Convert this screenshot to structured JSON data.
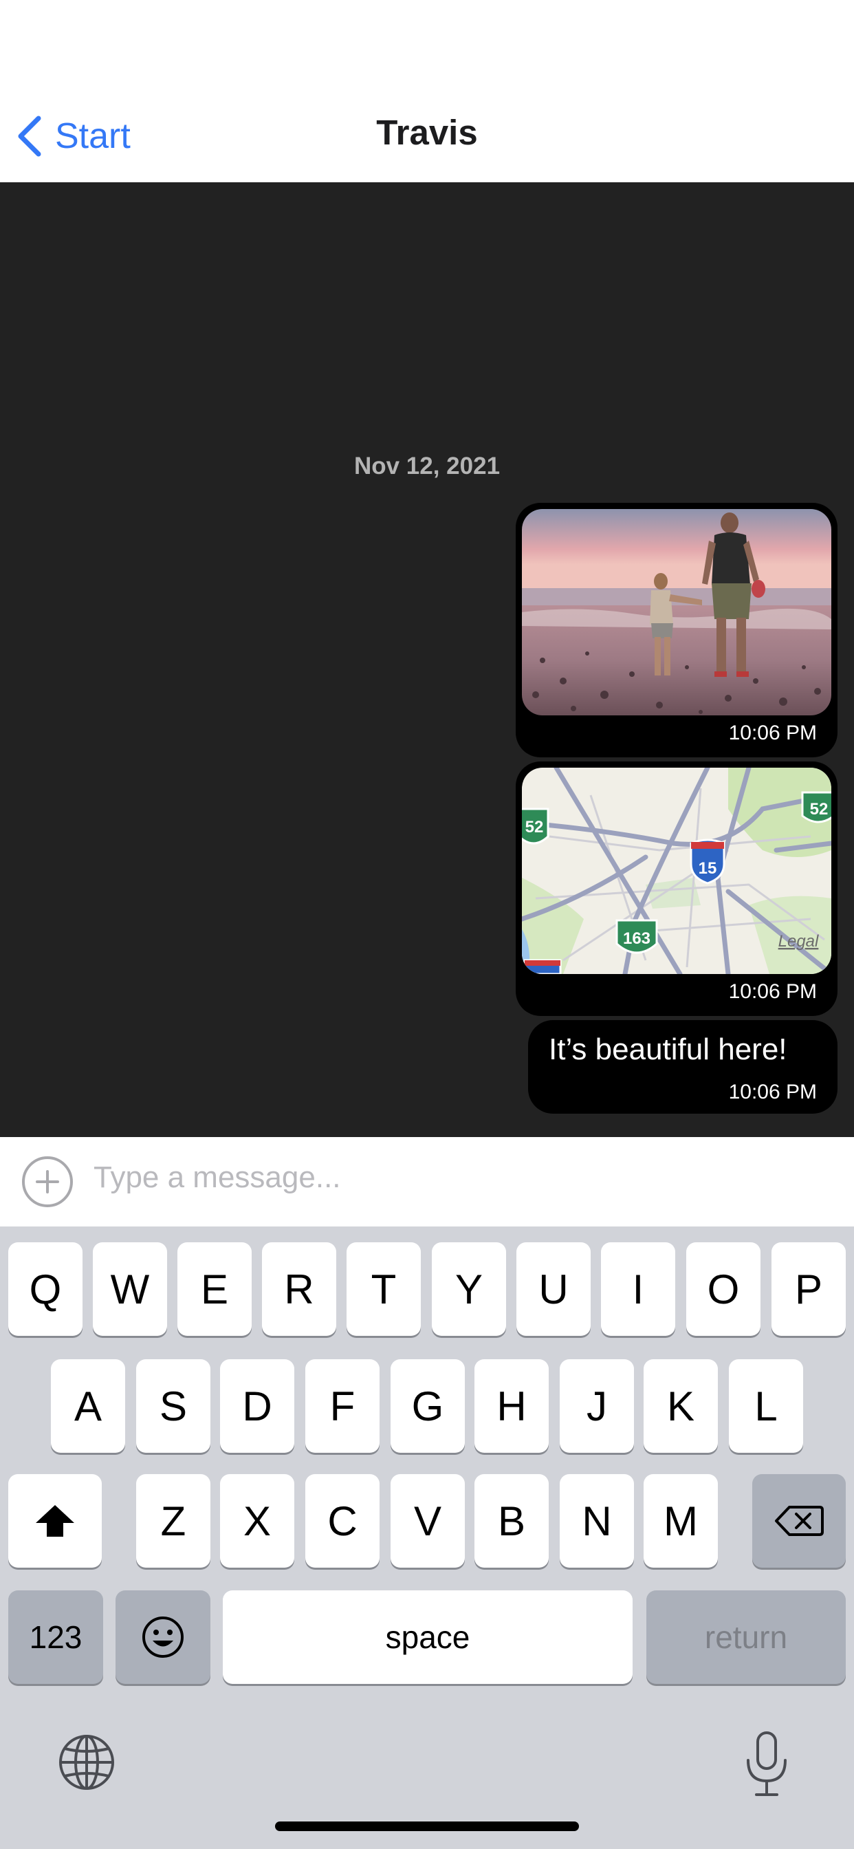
{
  "nav": {
    "back_label": "Start",
    "title": "Travis"
  },
  "chat": {
    "date_label": "Nov 12, 2021",
    "messages": [
      {
        "type": "photo",
        "time": "10:06 PM"
      },
      {
        "type": "map",
        "time": "10:06 PM",
        "route_labels": [
          "52",
          "15",
          "163",
          "52"
        ],
        "legal_label": "Legal"
      },
      {
        "type": "text",
        "text": "It’s beautiful here!",
        "time": "10:06 PM"
      }
    ]
  },
  "composer": {
    "placeholder": "Type a message..."
  },
  "keyboard": {
    "row1": [
      "Q",
      "W",
      "E",
      "R",
      "T",
      "Y",
      "U",
      "I",
      "O",
      "P"
    ],
    "row2": [
      "A",
      "S",
      "D",
      "F",
      "G",
      "H",
      "J",
      "K",
      "L"
    ],
    "row3": [
      "Z",
      "X",
      "C",
      "V",
      "B",
      "N",
      "M"
    ],
    "numbers_label": "123",
    "space_label": "space",
    "return_label": "return"
  },
  "icons": {
    "back": "chevron-left-icon",
    "add": "plus-circle-icon",
    "shift": "shift-icon",
    "delete": "delete-icon",
    "emoji": "emoji-icon",
    "globe": "globe-icon",
    "mic": "microphone-icon"
  },
  "colors": {
    "accent": "#3478f6",
    "chat_background": "#222222",
    "bubble": "#000000",
    "keyboard_background": "#d1d3d9",
    "key": "#ffffff",
    "key_dark": "#abb0ba"
  }
}
